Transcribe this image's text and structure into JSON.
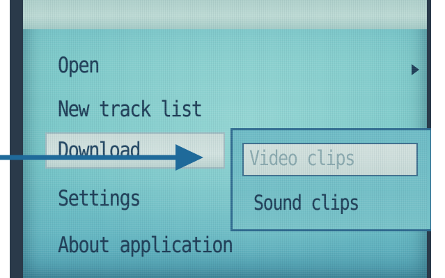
{
  "menu": {
    "items": [
      {
        "label": "Open",
        "has_submenu": true
      },
      {
        "label": "New track list"
      },
      {
        "label": "Download",
        "selected": true
      },
      {
        "label": "Settings"
      },
      {
        "label": "About application"
      }
    ]
  },
  "submenu": {
    "items": [
      {
        "label": "Video clips",
        "highlighted": true
      },
      {
        "label": "Sound clips"
      }
    ]
  },
  "colors": {
    "screen_background": "#7ac8c9",
    "menu_text": "#1f3e57",
    "highlight": "#d3e3e0",
    "pointer_arrow": "#1f6a9a"
  }
}
